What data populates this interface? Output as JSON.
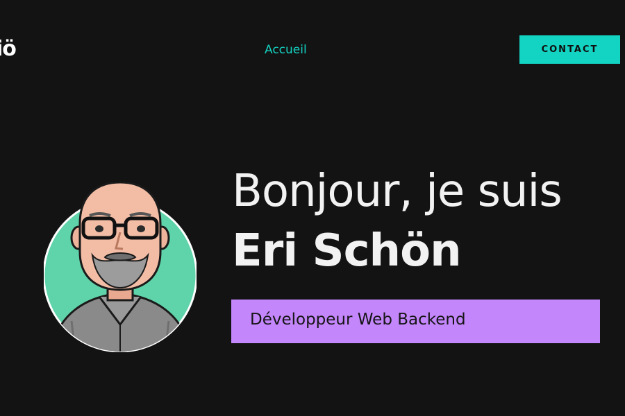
{
  "header": {
    "logo_text": "iö",
    "nav_home": "Accueil",
    "contact_label": "CONTACT"
  },
  "hero": {
    "greeting": "Bonjour, je suis",
    "name": "Eri Schön",
    "role": "Développeur Web Backend"
  },
  "colors": {
    "background": "#131313",
    "accent_teal": "#13d3c2",
    "role_box": "#c486fb",
    "avatar_circle": "#5fd3a9"
  },
  "icons": {
    "avatar": "developer-avatar-illustration"
  }
}
